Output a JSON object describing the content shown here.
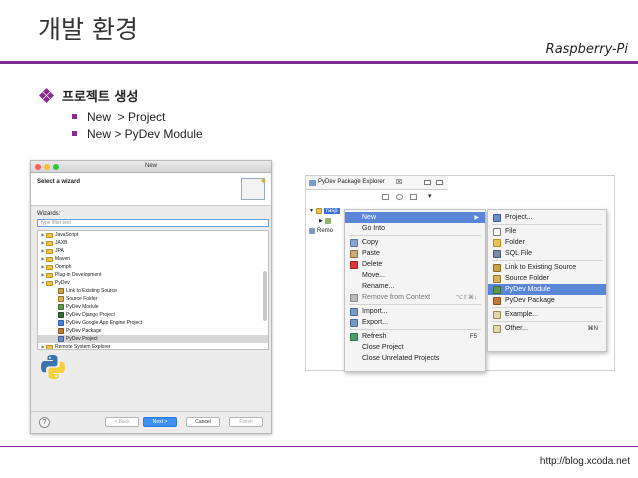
{
  "slide": {
    "title": "개발 환경",
    "subtitle": "Raspberry-Pi",
    "bullet_main": "프로젝트 생성",
    "sub_bullets": [
      "New  > Project",
      "New > PyDev Module"
    ],
    "footer_url": "http://blog.xcoda.net"
  },
  "wizard": {
    "window_title": "New",
    "header_title": "Select a wizard",
    "wizards_label": "Wizards:",
    "filter_placeholder": "type filter text",
    "tree": [
      {
        "label": "JavaScript",
        "level": 0,
        "twisty": "▶",
        "icon": "folder"
      },
      {
        "label": "JAXB",
        "level": 0,
        "twisty": "▶",
        "icon": "folder"
      },
      {
        "label": "JPA",
        "level": 0,
        "twisty": "▶",
        "icon": "folder"
      },
      {
        "label": "Maven",
        "level": 0,
        "twisty": "▶",
        "icon": "folder"
      },
      {
        "label": "Oomph",
        "level": 0,
        "twisty": "▶",
        "icon": "folder"
      },
      {
        "label": "Plug-in Development",
        "level": 0,
        "twisty": "▶",
        "icon": "folder"
      },
      {
        "label": "PyDev",
        "level": 0,
        "twisty": "▼",
        "icon": "folder"
      },
      {
        "label": "Link to Existing Source",
        "level": 1,
        "twisty": "",
        "icon": "link"
      },
      {
        "label": "Source Folder",
        "level": 1,
        "twisty": "",
        "icon": "srcfolder"
      },
      {
        "label": "PyDev Module",
        "level": 1,
        "twisty": "",
        "icon": "module"
      },
      {
        "label": "PyDev Django Project",
        "level": 1,
        "twisty": "",
        "icon": "django"
      },
      {
        "label": "PyDev Google App Engine Project",
        "level": 1,
        "twisty": "",
        "icon": "gae"
      },
      {
        "label": "PyDev Package",
        "level": 1,
        "twisty": "",
        "icon": "package"
      },
      {
        "label": "PyDev Project",
        "level": 1,
        "twisty": "",
        "icon": "project",
        "selected": true
      },
      {
        "label": "Remote System Explorer",
        "level": 0,
        "twisty": "▶",
        "icon": "folder"
      }
    ],
    "buttons": {
      "help": "?",
      "back": "< Back",
      "next": "Next >",
      "cancel": "Cancel",
      "finish": "Finish"
    },
    "colors": {
      "primary_button": "#3d8ff0",
      "close": "#fc5f57",
      "minimize": "#fdbc2e",
      "zoom": "#28c840"
    }
  },
  "explorer": {
    "tab_title": "PyDev Package Explorer",
    "tab_close": "☒",
    "rows": [
      {
        "label": "rasp",
        "selected": true
      },
      {
        "label": "",
        "selected": false
      },
      {
        "label": "Remo",
        "selected": false
      }
    ]
  },
  "context_menu": {
    "items": [
      {
        "label": "New",
        "arrow": "▶",
        "highlighted": true,
        "icon": ""
      },
      {
        "label": "Go Into",
        "icon": ""
      },
      {
        "sep": true
      },
      {
        "label": "Copy",
        "icon": "copy"
      },
      {
        "label": "Paste",
        "icon": "paste"
      },
      {
        "label": "Delete",
        "icon": "delete"
      },
      {
        "label": "Move...",
        "icon": ""
      },
      {
        "label": "Rename...",
        "icon": ""
      },
      {
        "label": "Remove from Context",
        "shortcut": "⌥⇧⌘↓",
        "icon": "remove",
        "disabled": true
      },
      {
        "sep": true
      },
      {
        "label": "Import...",
        "icon": "import"
      },
      {
        "label": "Export...",
        "icon": "export"
      },
      {
        "sep": true
      },
      {
        "label": "Refresh",
        "shortcut": "F5",
        "icon": "refresh"
      },
      {
        "label": "Close Project",
        "icon": ""
      },
      {
        "label": "Close Unrelated Projects",
        "icon": ""
      }
    ]
  },
  "submenu": {
    "items": [
      {
        "label": "Project...",
        "icon": "project"
      },
      {
        "sep": true
      },
      {
        "label": "File",
        "icon": "file"
      },
      {
        "label": "Folder",
        "icon": "folder"
      },
      {
        "label": "SQL File",
        "icon": "sql"
      },
      {
        "sep": true
      },
      {
        "label": "Link to Existing Source",
        "icon": "link"
      },
      {
        "label": "Source Folder",
        "icon": "srcfolder"
      },
      {
        "label": "PyDev Module",
        "icon": "module",
        "highlighted": true
      },
      {
        "label": "PyDev Package",
        "icon": "package"
      },
      {
        "sep": true
      },
      {
        "label": "Example...",
        "icon": "example"
      },
      {
        "sep": true
      },
      {
        "label": "Other...",
        "shortcut": "⌘N",
        "icon": "other"
      }
    ]
  },
  "accent_color": "#7b2f8f"
}
